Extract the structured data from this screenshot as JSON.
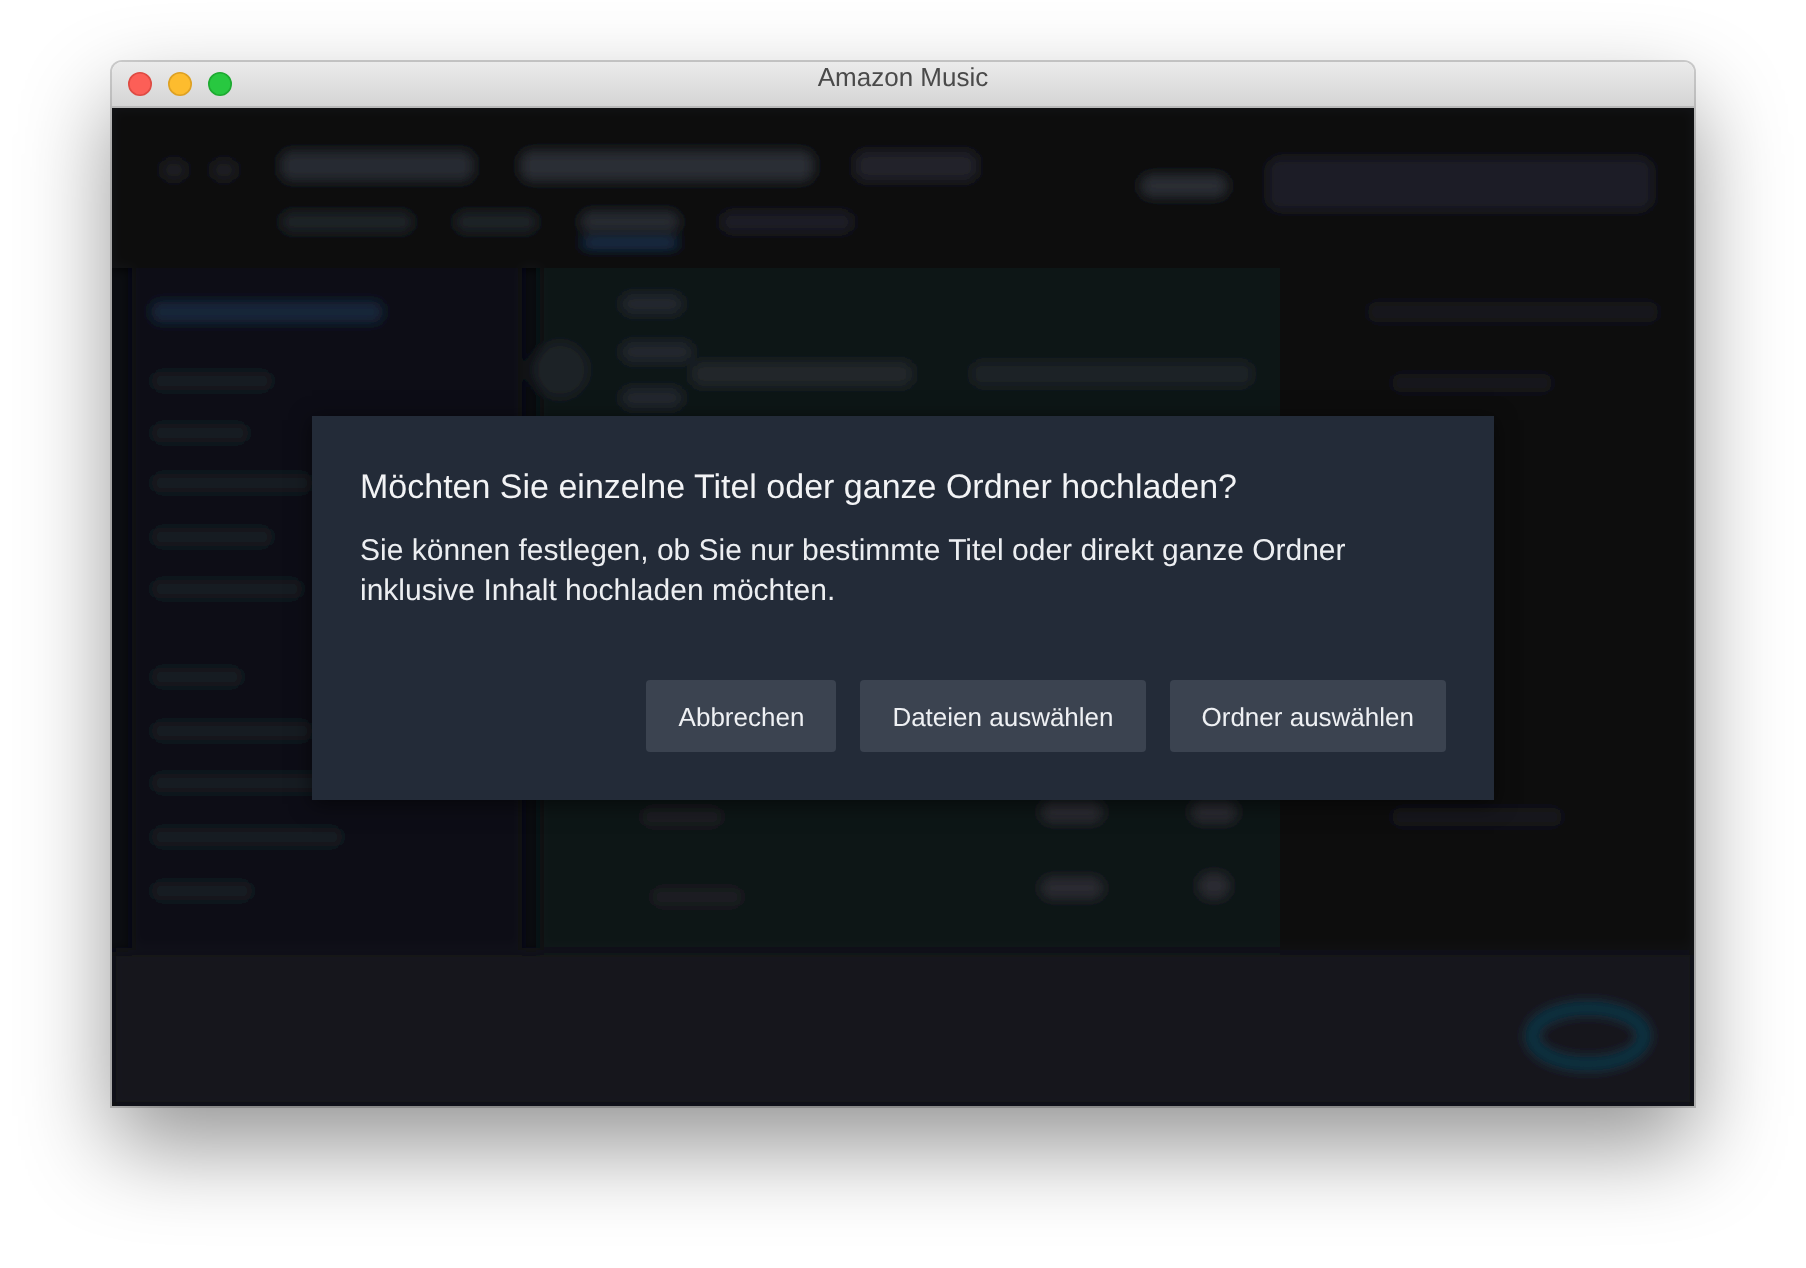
{
  "window": {
    "title": "Amazon Music"
  },
  "dialog": {
    "title": "Möchten Sie einzelne Titel oder ganze Ordner hochladen?",
    "message": "Sie können festlegen, ob Sie nur bestimmte Titel oder direkt ganze Ordner inklusive Inhalt hochladen möchten.",
    "buttons": [
      {
        "label": "Abbrechen"
      },
      {
        "label": "Dateien auswählen"
      },
      {
        "label": "Ordner auswählen"
      }
    ]
  }
}
